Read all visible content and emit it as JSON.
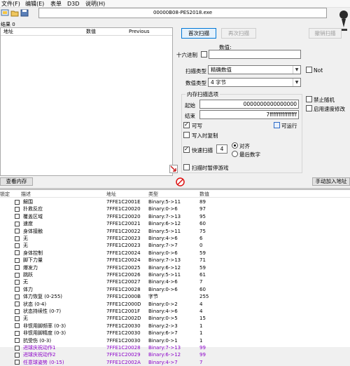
{
  "menu": {
    "items": [
      "文件(F)",
      "编辑(E)",
      "表单",
      "D3D",
      "说明(H)"
    ]
  },
  "window": {
    "title": "00000B08-PES2018.exe"
  },
  "results": {
    "label": "结果 0",
    "columns": [
      "地址",
      "数值",
      "Previous"
    ]
  },
  "scan": {
    "first_scan": "首次扫描",
    "next_scan": "再次扫描",
    "undo_scan": "撤销扫描",
    "value_label": "数值:",
    "hex_label": "十六进制",
    "scan_type_label": "扫描类型",
    "scan_type_value": "精确数值",
    "not_label": "Not",
    "value_type_label": "数值类型",
    "value_type_value": "4 字节",
    "memory_options_title": "内存扫描选项",
    "start_label": "起始",
    "start_value": "0000000000000000",
    "stop_label": "结束",
    "stop_value": "7fffffffffffffff",
    "writable": "可写",
    "executable": "可运行",
    "copy_on_write": "写入时复制",
    "fast_scan": "快速扫描",
    "fast_scan_value": "4",
    "alignment": "对齐",
    "last_digits": "最后数字",
    "pause_game": "扫描时暂停游戏",
    "disable_random": "禁止随机",
    "speedhack": "启用速度修改"
  },
  "buttons": {
    "view_memory": "查看内存",
    "add_manual": "手动加入地址"
  },
  "table": {
    "columns": [
      "锁定",
      "描述",
      "地址",
      "类型",
      "数值"
    ],
    "rows": [
      {
        "desc": "解围",
        "addr": "7FFE1C2001E",
        "type": "Binary:5->11",
        "value": "89",
        "purple": false
      },
      {
        "desc": "扑救反应",
        "addr": "7FFE1C20020",
        "type": "Binary:0->6",
        "value": "97",
        "purple": false
      },
      {
        "desc": "覆盖区域",
        "addr": "7FFE1C20020",
        "type": "Binary:7->13",
        "value": "95",
        "purple": false
      },
      {
        "desc": "速度",
        "addr": "7FFE1C20021",
        "type": "Binary:6->12",
        "value": "60",
        "purple": false
      },
      {
        "desc": "身体接触",
        "addr": "7FFE1C20022",
        "type": "Binary:5->11",
        "value": "75",
        "purple": false
      },
      {
        "desc": "无",
        "addr": "7FFE1C20023",
        "type": "Binary:4->6",
        "value": "6",
        "purple": false
      },
      {
        "desc": "无",
        "addr": "7FFE1C20023",
        "type": "Binary:7->7",
        "value": "0",
        "purple": false
      },
      {
        "desc": "身体控制",
        "addr": "7FFE1C20024",
        "type": "Binary:0->6",
        "value": "59",
        "purple": false
      },
      {
        "desc": "脚下力量",
        "addr": "7FFE1C20024",
        "type": "Binary:7->13",
        "value": "71",
        "purple": false
      },
      {
        "desc": "爆发力",
        "addr": "7FFE1C20025",
        "type": "Binary:6->12",
        "value": "59",
        "purple": false
      },
      {
        "desc": "跳跃",
        "addr": "7FFE1C20026",
        "type": "Binary:5->11",
        "value": "61",
        "purple": false
      },
      {
        "desc": "无",
        "addr": "7FFE1C20027",
        "type": "Binary:4->6",
        "value": "7",
        "purple": false
      },
      {
        "desc": "体力",
        "addr": "7FFE1C20028",
        "type": "Binary:0->6",
        "value": "60",
        "purple": false
      },
      {
        "desc": "体力恢复 (0-255)",
        "addr": "7FFE1C2000B",
        "type": "字节",
        "value": "255",
        "purple": false
      },
      {
        "desc": "状态 (0-4)",
        "addr": "7FFE1C2000D",
        "type": "Binary:0->2",
        "value": "4",
        "purple": false
      },
      {
        "desc": "状态持续性 (0-7)",
        "addr": "7FFE1C2001F",
        "type": "Binary:4->6",
        "value": "4",
        "purple": false
      },
      {
        "desc": "无",
        "addr": "7FFE1C2002D",
        "type": "Binary:0->5",
        "value": "15",
        "purple": false
      },
      {
        "desc": "非惯用脚频率 (0-3)",
        "addr": "7FFE1C20030",
        "type": "Binary:2->3",
        "value": "1",
        "purple": false
      },
      {
        "desc": "非惯用脚精度 (0-3)",
        "addr": "7FFE1C20030",
        "type": "Binary:6->7",
        "value": "1",
        "purple": false
      },
      {
        "desc": "抗受伤 (0-3)",
        "addr": "7FFE1C20030",
        "type": "Binary:0->1",
        "value": "1",
        "purple": false
      },
      {
        "desc": "进球庆祝动作1",
        "addr": "7FFE1C20028",
        "type": "Binary:7->13",
        "value": "99",
        "purple": true
      },
      {
        "desc": "进球庆祝动作2",
        "addr": "7FFE1C20029",
        "type": "Binary:6->12",
        "value": "99",
        "purple": true
      },
      {
        "desc": "任意球姿势 (0-15)",
        "addr": "7FFE1C2002A",
        "type": "Binary:4->7",
        "value": "7",
        "purple": true
      }
    ]
  }
}
